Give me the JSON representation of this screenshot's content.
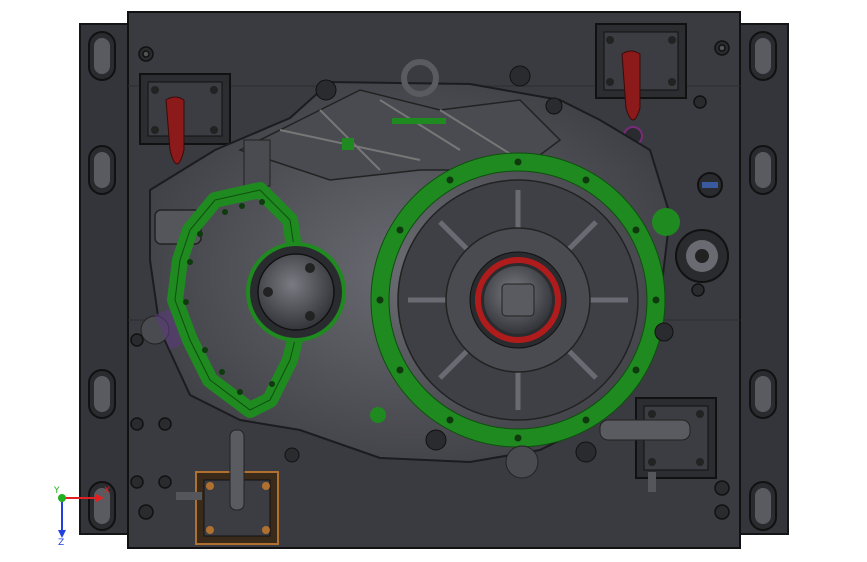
{
  "viewport": {
    "background": "#ffffff",
    "base_plate_color": "#3a3b40",
    "plate_edge_color": "#1e1f22",
    "housing_color": "#55565c",
    "gasket_color": "#1f8a1f",
    "gasket_edge_color": "#0e4f0e",
    "clamp_handle_color": "#8c1a1a",
    "seal_ring_color": "#b01c1c",
    "bracket_color": "#b07030"
  },
  "triad": {
    "x_label": "X",
    "y_label": "Y",
    "z_label": "Z",
    "x_color": "#e02020",
    "y_color": "#20b020",
    "z_color": "#2040e0"
  }
}
